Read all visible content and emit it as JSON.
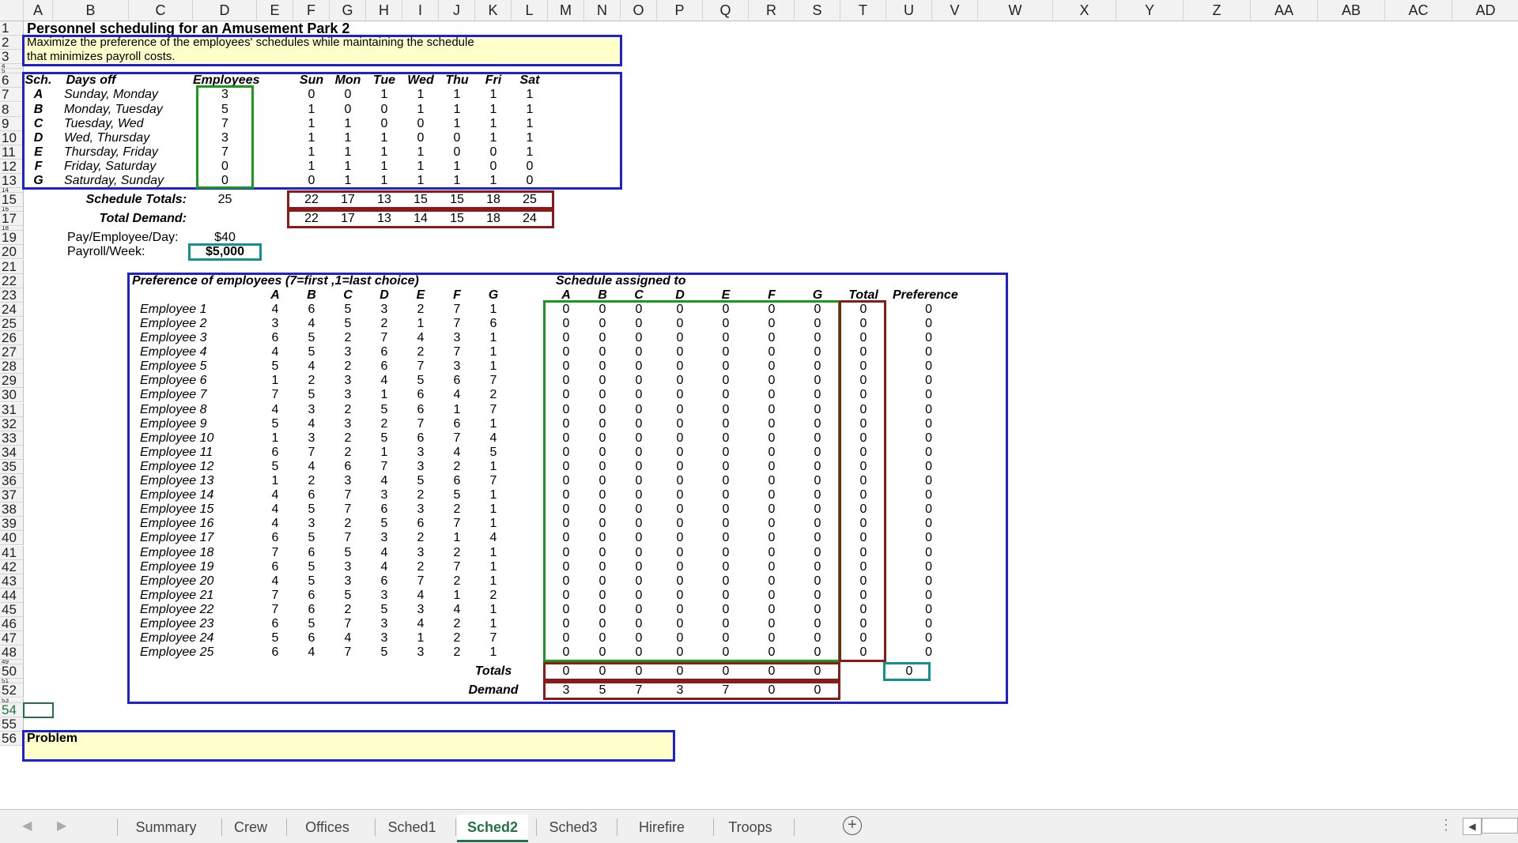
{
  "columns": [
    "A",
    "B",
    "C",
    "D",
    "E",
    "F",
    "G",
    "H",
    "I",
    "J",
    "K",
    "L",
    "M",
    "N",
    "O",
    "P",
    "Q",
    "R",
    "S",
    "T",
    "U",
    "V",
    "W",
    "X",
    "Y",
    "Z",
    "AA",
    "AB",
    "AC",
    "AD"
  ],
  "rows": [
    "1",
    "2",
    "3",
    "4",
    "5",
    "6",
    "7",
    "8",
    "9",
    "10",
    "11",
    "12",
    "13",
    "14",
    "15",
    "16",
    "17",
    "18",
    "19",
    "20",
    "21",
    "22",
    "23",
    "24",
    "25",
    "26",
    "27",
    "28",
    "29",
    "30",
    "31",
    "32",
    "33",
    "34",
    "35",
    "36",
    "37",
    "38",
    "39",
    "40",
    "41",
    "42",
    "43",
    "44",
    "45",
    "46",
    "47",
    "48",
    "49",
    "50",
    "51",
    "52",
    "53",
    "54",
    "55",
    "56"
  ],
  "selected_row": "54",
  "title": "Personnel scheduling for an Amusement Park 2",
  "description_line1": "Maximize the preference of the employees' schedules while maintaining the schedule",
  "description_line2": "that minimizes payroll costs.",
  "schedule_header": {
    "sch": "Sch.",
    "days_off": "Days off",
    "employees": "Employees",
    "days": [
      "Sun",
      "Mon",
      "Tue",
      "Wed",
      "Thu",
      "Fri",
      "Sat"
    ]
  },
  "schedules": [
    {
      "sch": "A",
      "days_off": "Sunday, Monday",
      "employees": "3",
      "days": [
        "0",
        "0",
        "1",
        "1",
        "1",
        "1",
        "1"
      ]
    },
    {
      "sch": "B",
      "days_off": "Monday, Tuesday",
      "employees": "5",
      "days": [
        "1",
        "0",
        "0",
        "1",
        "1",
        "1",
        "1"
      ]
    },
    {
      "sch": "C",
      "days_off": "Tuesday, Wed",
      "employees": "7",
      "days": [
        "1",
        "1",
        "0",
        "0",
        "1",
        "1",
        "1"
      ]
    },
    {
      "sch": "D",
      "days_off": "Wed, Thursday",
      "employees": "3",
      "days": [
        "1",
        "1",
        "1",
        "0",
        "0",
        "1",
        "1"
      ]
    },
    {
      "sch": "E",
      "days_off": "Thursday, Friday",
      "employees": "7",
      "days": [
        "1",
        "1",
        "1",
        "1",
        "0",
        "0",
        "1"
      ]
    },
    {
      "sch": "F",
      "days_off": "Friday, Saturday",
      "employees": "0",
      "days": [
        "1",
        "1",
        "1",
        "1",
        "1",
        "0",
        "0"
      ]
    },
    {
      "sch": "G",
      "days_off": "Saturday, Sunday",
      "employees": "0",
      "days": [
        "0",
        "1",
        "1",
        "1",
        "1",
        "1",
        "0"
      ]
    }
  ],
  "schedule_totals": {
    "label": "Schedule Totals:",
    "employees": "25",
    "days": [
      "22",
      "17",
      "13",
      "15",
      "15",
      "18",
      "25"
    ]
  },
  "total_demand": {
    "label": "Total Demand:",
    "days": [
      "22",
      "17",
      "13",
      "14",
      "15",
      "18",
      "24"
    ]
  },
  "pay_label": "Pay/Employee/Day:",
  "pay_value": "$40",
  "payroll_label": "Payroll/Week:",
  "payroll_value": "$5,000",
  "pref_title": "Preference of employees (7=first ,1=last choice)",
  "assign_title": "Schedule assigned to",
  "sched_letters": [
    "A",
    "B",
    "C",
    "D",
    "E",
    "F",
    "G"
  ],
  "total_label": "Total",
  "preference_label": "Preference",
  "employees": [
    {
      "name": "Employee 1",
      "prefs": [
        "4",
        "6",
        "5",
        "3",
        "2",
        "7",
        "1"
      ]
    },
    {
      "name": "Employee 2",
      "prefs": [
        "3",
        "4",
        "5",
        "2",
        "1",
        "7",
        "6"
      ]
    },
    {
      "name": "Employee 3",
      "prefs": [
        "6",
        "5",
        "2",
        "7",
        "4",
        "3",
        "1"
      ]
    },
    {
      "name": "Employee 4",
      "prefs": [
        "4",
        "5",
        "3",
        "6",
        "2",
        "7",
        "1"
      ]
    },
    {
      "name": "Employee 5",
      "prefs": [
        "5",
        "4",
        "2",
        "6",
        "7",
        "3",
        "1"
      ]
    },
    {
      "name": "Employee 6",
      "prefs": [
        "1",
        "2",
        "3",
        "4",
        "5",
        "6",
        "7"
      ]
    },
    {
      "name": "Employee 7",
      "prefs": [
        "7",
        "5",
        "3",
        "1",
        "6",
        "4",
        "2"
      ]
    },
    {
      "name": "Employee 8",
      "prefs": [
        "4",
        "3",
        "2",
        "5",
        "6",
        "1",
        "7"
      ]
    },
    {
      "name": "Employee 9",
      "prefs": [
        "5",
        "4",
        "3",
        "2",
        "7",
        "6",
        "1"
      ]
    },
    {
      "name": "Employee 10",
      "prefs": [
        "1",
        "3",
        "2",
        "5",
        "6",
        "7",
        "4"
      ]
    },
    {
      "name": "Employee 11",
      "prefs": [
        "6",
        "7",
        "2",
        "1",
        "3",
        "4",
        "5"
      ]
    },
    {
      "name": "Employee 12",
      "prefs": [
        "5",
        "4",
        "6",
        "7",
        "3",
        "2",
        "1"
      ]
    },
    {
      "name": "Employee 13",
      "prefs": [
        "1",
        "2",
        "3",
        "4",
        "5",
        "6",
        "7"
      ]
    },
    {
      "name": "Employee 14",
      "prefs": [
        "4",
        "6",
        "7",
        "3",
        "2",
        "5",
        "1"
      ]
    },
    {
      "name": "Employee 15",
      "prefs": [
        "4",
        "5",
        "7",
        "6",
        "3",
        "2",
        "1"
      ]
    },
    {
      "name": "Employee 16",
      "prefs": [
        "4",
        "3",
        "2",
        "5",
        "6",
        "7",
        "1"
      ]
    },
    {
      "name": "Employee 17",
      "prefs": [
        "6",
        "5",
        "7",
        "3",
        "2",
        "1",
        "4"
      ]
    },
    {
      "name": "Employee 18",
      "prefs": [
        "7",
        "6",
        "5",
        "4",
        "3",
        "2",
        "1"
      ]
    },
    {
      "name": "Employee 19",
      "prefs": [
        "6",
        "5",
        "3",
        "4",
        "2",
        "7",
        "1"
      ]
    },
    {
      "name": "Employee 20",
      "prefs": [
        "4",
        "5",
        "3",
        "6",
        "7",
        "2",
        "1"
      ]
    },
    {
      "name": "Employee 21",
      "prefs": [
        "7",
        "6",
        "5",
        "3",
        "4",
        "1",
        "2"
      ]
    },
    {
      "name": "Employee 22",
      "prefs": [
        "7",
        "6",
        "2",
        "5",
        "3",
        "4",
        "1"
      ]
    },
    {
      "name": "Employee 23",
      "prefs": [
        "6",
        "5",
        "7",
        "3",
        "4",
        "2",
        "1"
      ]
    },
    {
      "name": "Employee 24",
      "prefs": [
        "5",
        "6",
        "4",
        "3",
        "1",
        "2",
        "7"
      ]
    },
    {
      "name": "Employee 25",
      "prefs": [
        "6",
        "4",
        "7",
        "5",
        "3",
        "2",
        "1"
      ]
    }
  ],
  "assign_value": "0",
  "totals_label": "Totals",
  "totals_values": [
    "0",
    "0",
    "0",
    "0",
    "0",
    "0",
    "0"
  ],
  "totals_preference": "0",
  "demand_label": "Demand",
  "demand_values": [
    "3",
    "5",
    "7",
    "3",
    "7",
    "0",
    "0"
  ],
  "problem_label": "Problem",
  "tabs": [
    "Summary",
    "Crew",
    "Offices",
    "Sched1",
    "Sched2",
    "Sched3",
    "Hirefire",
    "Troops"
  ],
  "active_tab": "Sched2",
  "colors": {
    "blue_border": "#1f1fd6",
    "green_border": "#1a9a1a",
    "red_border": "#8b1a1a",
    "teal_border": "#129191",
    "note_fill": "#ffffcc",
    "active_tab": "#217346"
  },
  "icons": [
    "scroll-left-icon",
    "scroll-right-icon",
    "add-sheet-icon",
    "more-options-icon",
    "hscroll-left-icon"
  ]
}
